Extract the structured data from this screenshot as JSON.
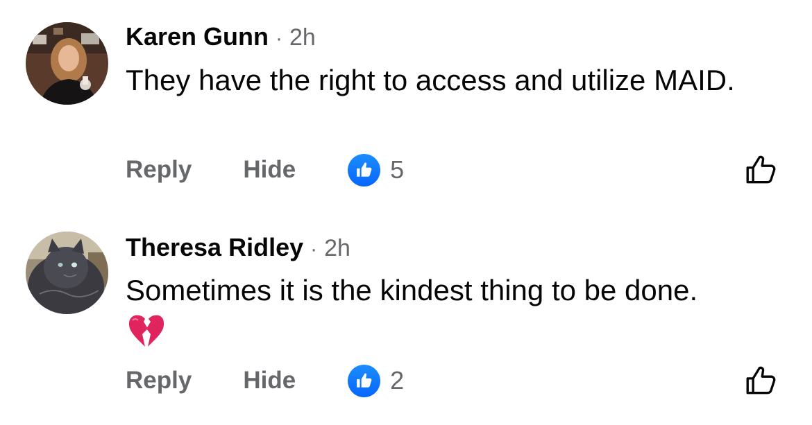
{
  "comments": [
    {
      "author": "Karen Gunn",
      "separator": "·",
      "time": "2h",
      "text": "They have the right to access and utilize MAID.",
      "reply_label": "Reply",
      "hide_label": "Hide",
      "like_count": "5"
    },
    {
      "author": "Theresa Ridley",
      "separator": "·",
      "time": "2h",
      "text": "Sometimes it is the kindest thing to be done.",
      "emoji": "broken-heart-emoji",
      "reply_label": "Reply",
      "hide_label": "Hide",
      "like_count": "2"
    }
  ],
  "colors": {
    "text": "#050505",
    "muted": "#65676b",
    "like_blue": "#0866ff"
  },
  "icons": [
    "like-badge-icon",
    "like-outline-icon",
    "broken-heart-icon"
  ]
}
